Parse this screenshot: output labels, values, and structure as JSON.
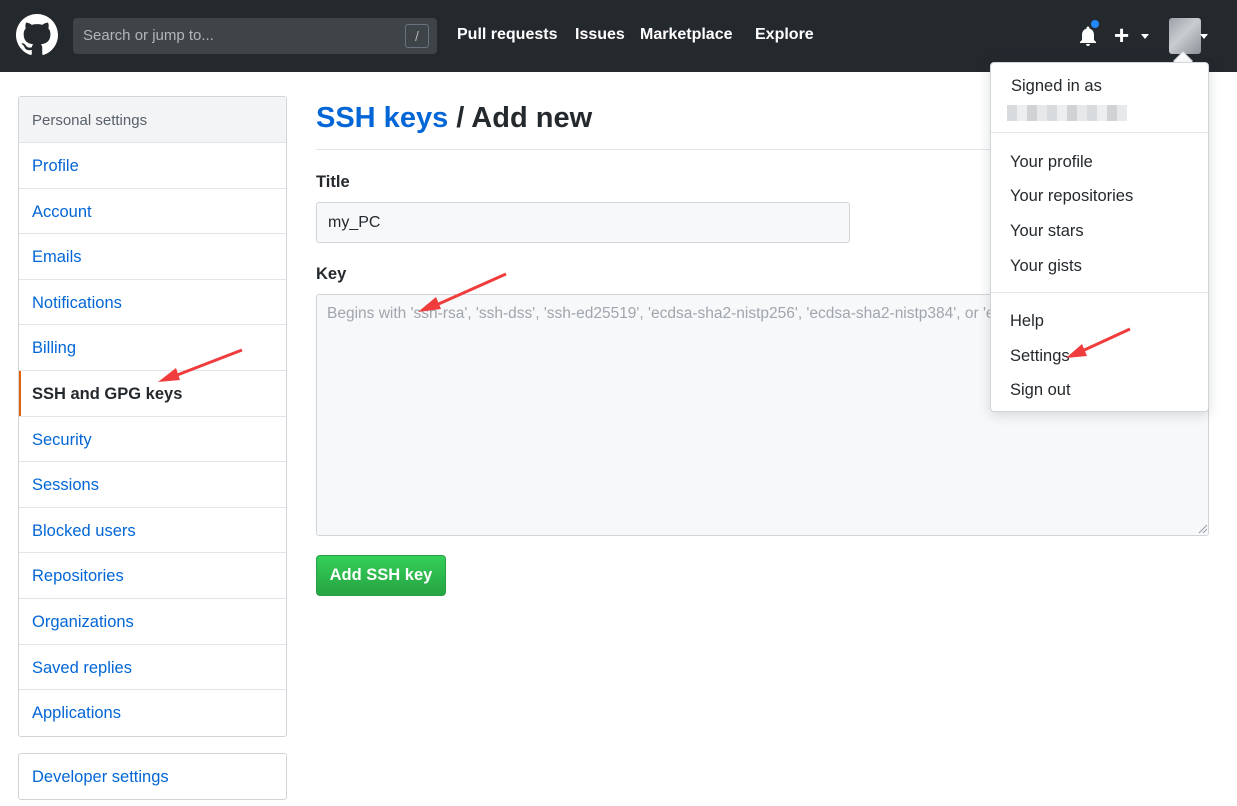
{
  "header": {
    "search_placeholder": "Search or jump to...",
    "search_shortcut": "/",
    "nav": [
      "Pull requests",
      "Issues",
      "Marketplace",
      "Explore"
    ],
    "notification_dot_color": "#2188ff"
  },
  "sidebar": {
    "heading": "Personal settings",
    "items": [
      {
        "label": "Profile"
      },
      {
        "label": "Account"
      },
      {
        "label": "Emails"
      },
      {
        "label": "Notifications"
      },
      {
        "label": "Billing"
      },
      {
        "label": "SSH and GPG keys",
        "selected": true
      },
      {
        "label": "Security"
      },
      {
        "label": "Sessions"
      },
      {
        "label": "Blocked users"
      },
      {
        "label": "Repositories"
      },
      {
        "label": "Organizations"
      },
      {
        "label": "Saved replies"
      },
      {
        "label": "Applications"
      }
    ],
    "developer_settings": "Developer settings"
  },
  "main": {
    "breadcrumb_link": "SSH keys",
    "breadcrumb_rest": " / Add new",
    "title_label": "Title",
    "title_value": "my_PC",
    "key_label": "Key",
    "key_placeholder": "Begins with 'ssh-rsa', 'ssh-dss', 'ssh-ed25519', 'ecdsa-sha2-nistp256', 'ecdsa-sha2-nistp384', or 'ecdsa-sha2-nistp521'",
    "submit_label": "Add SSH key"
  },
  "dropdown": {
    "signed_in_as": "Signed in as",
    "profile_items": [
      "Your profile",
      "Your repositories",
      "Your stars",
      "Your gists"
    ],
    "help": "Help",
    "settings": "Settings",
    "sign_out": "Sign out"
  },
  "colors": {
    "header_bg": "#24292e",
    "link": "#0366d6",
    "selected_accent": "#e36209",
    "button_green": "#28a745",
    "annotation_arrow": "#f03c3c"
  }
}
